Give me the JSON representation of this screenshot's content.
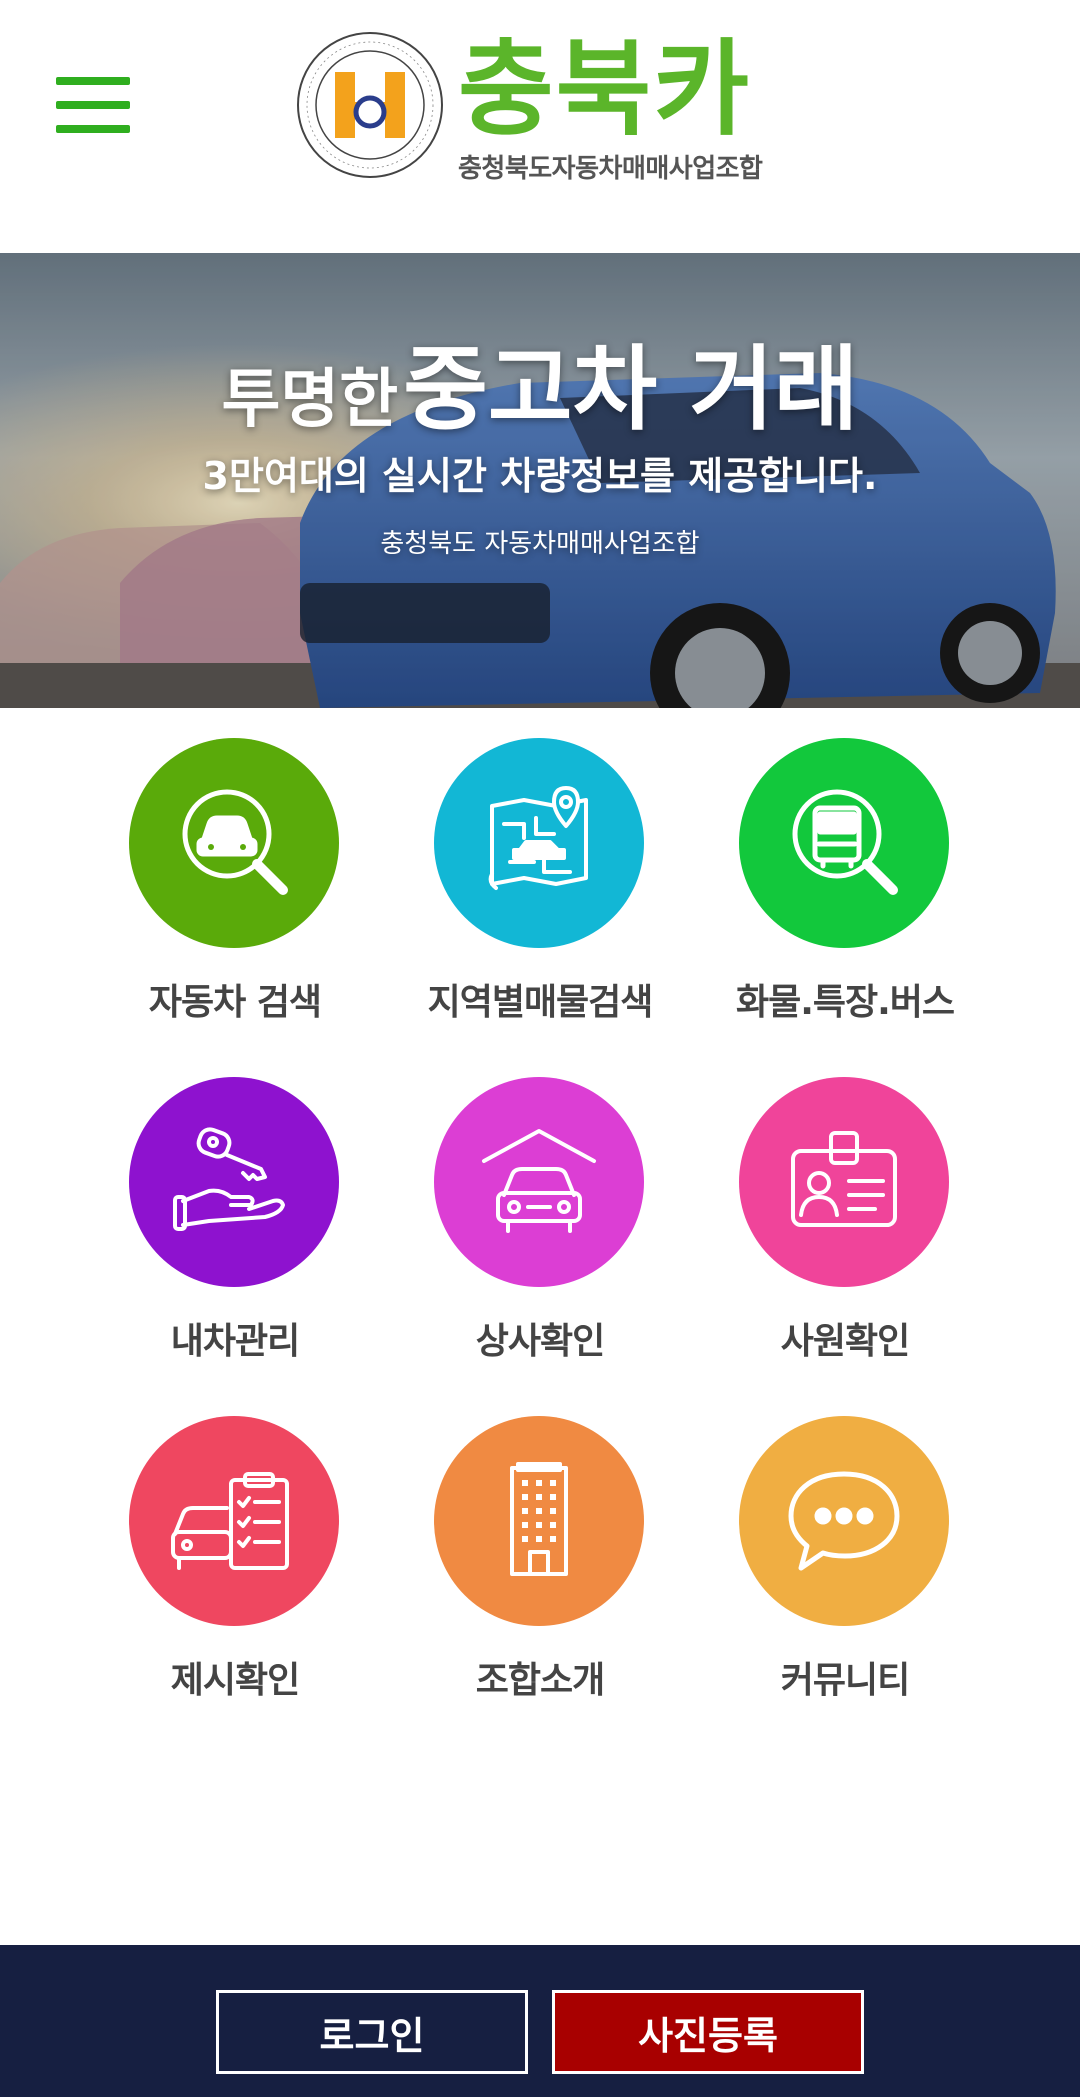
{
  "header": {
    "menu_icon": "hamburger-menu-icon",
    "logo_title": "충북카",
    "logo_subtitle": "충청북도자동차매매사업조합",
    "brand_color": "#5bb52a",
    "menu_color": "#2fae1f"
  },
  "banner": {
    "headline_small": "투명한",
    "headline_big": "중고차 거래",
    "subtitle": "3만여대의 실시간 차량정보를 제공합니다.",
    "org": "충청북도 자동차매매사업조합"
  },
  "menu": [
    {
      "label": "자동차 검색",
      "icon": "car-search-icon",
      "color": "#5aaa0a"
    },
    {
      "label": "지역별매물검색",
      "icon": "map-car-icon",
      "color": "#12b7d5"
    },
    {
      "label": "화물.특장.버스",
      "icon": "truck-search-icon",
      "color": "#12c83c"
    },
    {
      "label": "내차관리",
      "icon": "key-hand-icon",
      "color": "#8e12cf"
    },
    {
      "label": "상사확인",
      "icon": "car-garage-icon",
      "color": "#dc3ed4"
    },
    {
      "label": "사원확인",
      "icon": "id-card-icon",
      "color": "#f0449a"
    },
    {
      "label": "제시확인",
      "icon": "car-checklist-icon",
      "color": "#ef4760"
    },
    {
      "label": "조합소개",
      "icon": "building-icon",
      "color": "#f08a42"
    },
    {
      "label": "커뮤니티",
      "icon": "chat-bubble-icon",
      "color": "#f0ae42"
    }
  ],
  "footer": {
    "login_label": "로그인",
    "photo_label": "사진등록",
    "bg_color": "#161f41",
    "photo_btn_color": "#a80000"
  }
}
